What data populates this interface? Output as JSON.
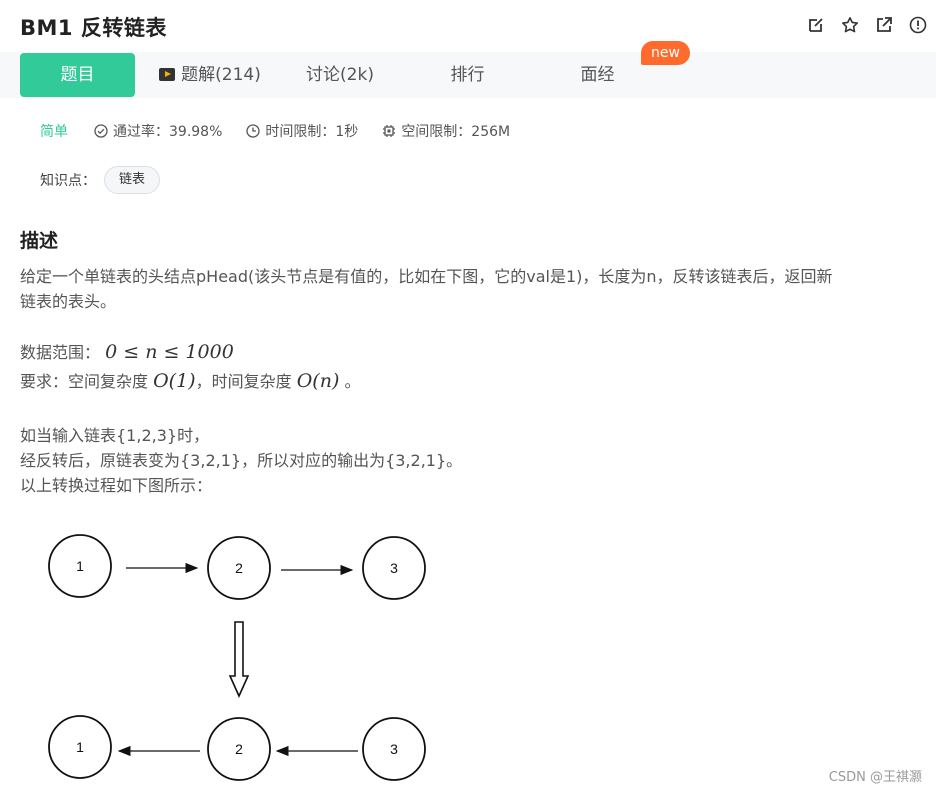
{
  "header": {
    "title": "BM1  反转链表",
    "actions": [
      "edit-icon",
      "star-icon",
      "share-icon",
      "info-icon"
    ]
  },
  "tabs": [
    {
      "label": "题目",
      "active": true
    },
    {
      "label": "题解(214)",
      "active": false
    },
    {
      "label": "讨论(2k)",
      "active": false
    },
    {
      "label": "排行",
      "active": false
    },
    {
      "label": "面经",
      "active": false
    }
  ],
  "badge": "new",
  "meta": {
    "difficulty": "简单",
    "pass_rate": "通过率：39.98%",
    "time_limit": "时间限制：1秒",
    "memory_limit": "空间限制：256M"
  },
  "knowledge": {
    "label": "知识点：",
    "tag": "链表"
  },
  "description": {
    "heading": "描述",
    "line1": "给定一个单链表的头结点pHead(该头节点是有值的，比如在下图，它的val是1)，长度为n，反转该链表后，返回新",
    "line2": "链表的表头。",
    "range_label": "数据范围：",
    "range_math": "0 ≤ n ≤ 1000",
    "req_label": "要求：空间复杂度",
    "space_math": "O(1)",
    "req_mid": "，时间复杂度",
    "time_math": "O(n)",
    "req_end": "。",
    "example1": "如当输入链表{1,2,3}时，",
    "example2": "经反转后，原链表变为{3,2,1}，所以对应的输出为{3,2,1}。",
    "example3": "以上转换过程如下图所示："
  },
  "diagram": {
    "top_nodes": [
      "1",
      "2",
      "3"
    ],
    "bottom_nodes": [
      "1",
      "2",
      "3"
    ]
  },
  "watermark": "CSDN @王祺灏"
}
